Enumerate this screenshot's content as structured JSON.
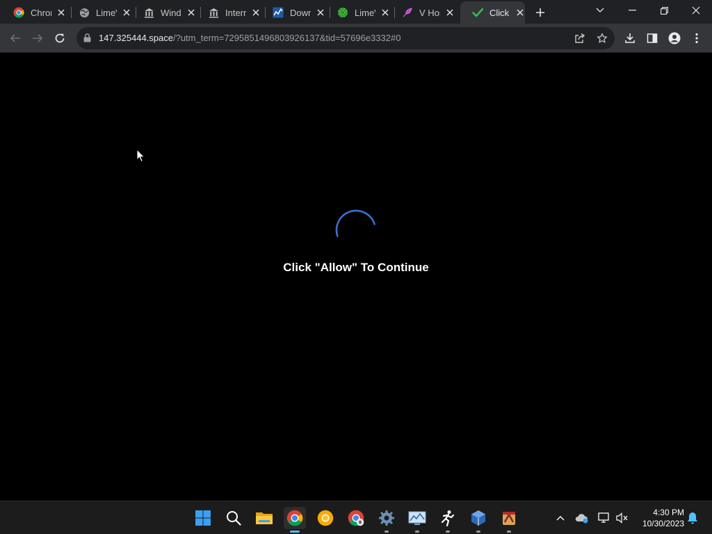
{
  "browser": {
    "tabs": [
      {
        "title": "Chror",
        "icon": "chrome-icon"
      },
      {
        "title": "LimeV",
        "icon": "globe-icon"
      },
      {
        "title": "Windo",
        "icon": "bank-icon"
      },
      {
        "title": "Interr",
        "icon": "bank-icon"
      },
      {
        "title": "Down",
        "icon": "chart-icon"
      },
      {
        "title": "LimeV",
        "icon": "limewire-icon"
      },
      {
        "title": "V Hos",
        "icon": "feather-icon"
      },
      {
        "title": "Click",
        "icon": "checkmark-icon",
        "active": true
      }
    ],
    "url_host": "147.325444.space",
    "url_rest": "/?utm_term=7295851496803926137&tid=57696e3332#0"
  },
  "page": {
    "message": "Click \"Allow\" To Continue",
    "spinner_color": "#3d6fd1"
  },
  "taskbar": {
    "time": "4:30 PM",
    "date": "10/30/2023",
    "apps": [
      "start-icon",
      "search-icon",
      "file-explorer-icon",
      "chrome-icon",
      "chrome-canary-icon",
      "chrome-dev-icon",
      "settings-icon",
      "monitor-icon",
      "runner-icon",
      "virtualbox-icon",
      "app-icon"
    ]
  },
  "colors": {
    "tabstrip": "#202124",
    "toolbar": "#35363a",
    "omnibox": "#202124",
    "taskbar": "#1c1c1c",
    "accent": "#4cc2ff"
  }
}
